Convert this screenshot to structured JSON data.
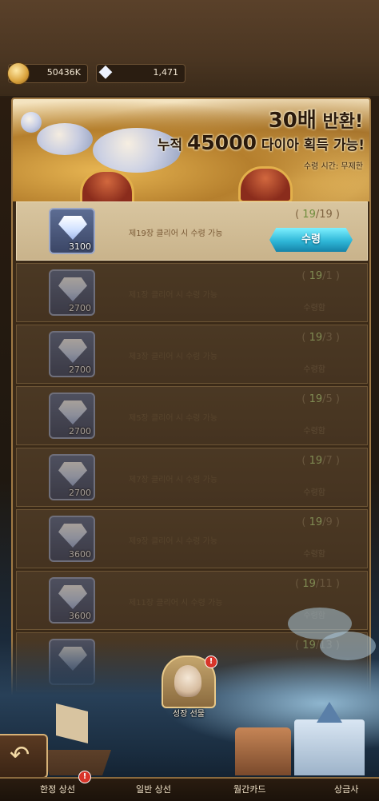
{
  "currency": {
    "gold": "50436K",
    "diamond": "1,471"
  },
  "banner": {
    "line1_big": "30배",
    "line1_rest": "반환!",
    "line2_prefix": "누적",
    "line2_big": "45000",
    "line2_rest": "다이아 획득 가능!",
    "line3": "수령 시간: 무제한"
  },
  "rewards": [
    {
      "qty": "3100",
      "condition": "제19장 클리어 시 수령 가능",
      "current": "19",
      "target": "19",
      "state": "수령",
      "active": true
    },
    {
      "qty": "2700",
      "condition": "제1장 클리어 시 수령 가능",
      "current": "19",
      "target": "1",
      "state": "수령함",
      "active": false
    },
    {
      "qty": "2700",
      "condition": "제3장 클리어 시 수령 가능",
      "current": "19",
      "target": "3",
      "state": "수령함",
      "active": false
    },
    {
      "qty": "2700",
      "condition": "제5장 클리어 시 수령 가능",
      "current": "19",
      "target": "5",
      "state": "수령함",
      "active": false
    },
    {
      "qty": "2700",
      "condition": "제7장 클리어 시 수령 가능",
      "current": "19",
      "target": "7",
      "state": "수령함",
      "active": false
    },
    {
      "qty": "3600",
      "condition": "제9장 클리어 시 수령 가능",
      "current": "19",
      "target": "9",
      "state": "수령함",
      "active": false
    },
    {
      "qty": "3600",
      "condition": "제11장 클리어 시 수령 가능",
      "current": "19",
      "target": "11",
      "state": "수령함",
      "active": false
    },
    {
      "qty": "",
      "condition": "",
      "current": "19",
      "target": "13",
      "state": "",
      "active": false
    }
  ],
  "gift": {
    "label": "성장 선물",
    "badge": "!"
  },
  "nav": {
    "items": [
      "한정 상선",
      "일반 상선",
      "월간카드",
      "상금사"
    ],
    "badge": "!"
  },
  "icons": {
    "gold": "gold-coin-icon",
    "diamond": "diamond-icon",
    "back": "back-arrow-icon"
  },
  "colors": {
    "claim_button": "#2fb7d8",
    "progress_number": "#b7d77c",
    "badge": "#d8352a"
  }
}
